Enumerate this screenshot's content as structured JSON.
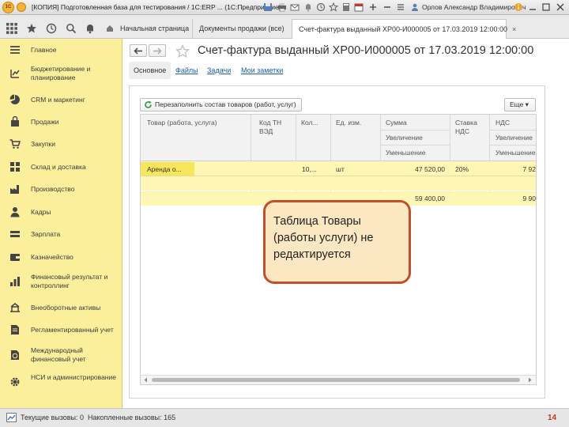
{
  "window": {
    "logo_text": "1С",
    "title": "[КОПИЯ] Подготовленная база для тестирования / 1C:ERP ... (1С:Предприятие)",
    "user": "Орлов Александр Владимирович",
    "icons": [
      "save-icon",
      "print-icon",
      "mail-icon",
      "bell-icon",
      "history-icon",
      "star-icon",
      "calculator-icon",
      "calendar-icon",
      "plus-icon",
      "minus-icon",
      "menu-icon",
      "user-icon",
      "info-icon"
    ]
  },
  "tabs": [
    {
      "label": "Начальная страница"
    },
    {
      "label": "Документы продажи (все)"
    },
    {
      "label": "Счет-фактура выданный ХР00-И000005 от 17.03.2019 12:00:00",
      "close": "×"
    }
  ],
  "sidebar": {
    "items": [
      {
        "label": "Главное",
        "icon": "list-icon"
      },
      {
        "label": "Бюджетирование и планирование",
        "icon": "budget-icon"
      },
      {
        "label": "CRM и маркетинг",
        "icon": "pie-icon"
      },
      {
        "label": "Продажи",
        "icon": "bag-icon"
      },
      {
        "label": "Закупки",
        "icon": "cart-icon"
      },
      {
        "label": "Склад и доставка",
        "icon": "warehouse-icon"
      },
      {
        "label": "Производство",
        "icon": "factory-icon"
      },
      {
        "label": "Кадры",
        "icon": "person-icon"
      },
      {
        "label": "Зарплата",
        "icon": "money-icon"
      },
      {
        "label": "Казначейство",
        "icon": "treasury-icon"
      },
      {
        "label": "Финансовый результат и контроллинг",
        "icon": "chart-icon"
      },
      {
        "label": "Внеоборотные активы",
        "icon": "assets-icon"
      },
      {
        "label": "Регламентированный учет",
        "icon": "document-icon"
      },
      {
        "label": "Международный финансовый учет",
        "icon": "globe-doc-icon"
      },
      {
        "label": "НСИ и администрирование",
        "icon": "gear-icon"
      }
    ]
  },
  "document": {
    "title": "Счет-фактура выданный ХР00-И000005 от 17.03.2019 12:00:00",
    "subtabs": [
      "Основное",
      "Файлы",
      "Задачи",
      "Мои заметки"
    ],
    "refill_button": "Перезаполнить состав товаров (работ, услуг)",
    "more_button": "Еще ▾",
    "columns": {
      "product": "Товар (работа, услуга)",
      "tn_ved": "Код ТН ВЭД",
      "qty": "Кол...",
      "unit": "Ед. изм.",
      "sum": "Сумма",
      "sum_increase": "Увеличение",
      "sum_decrease": "Уменьшение",
      "vat_rate": "Ставка НДС",
      "vat": "НДС",
      "vat_increase": "Увеличение",
      "vat_decrease": "Уменьшение"
    },
    "rows": [
      {
        "product": "Аренда о...",
        "qty": "10,...",
        "unit": "шт",
        "sum": "47 520,00",
        "vat_rate": "20%",
        "vat": "7 92"
      }
    ],
    "totals": {
      "sum": "59 400,00",
      "vat": "9 90"
    }
  },
  "callout": {
    "text": "Таблица Товары (работы услуги) не редактируется"
  },
  "status": {
    "current_calls": "Текущие вызовы: 0",
    "accumulated_calls": "Накопленные вызовы: 165"
  },
  "page_number": "14"
}
